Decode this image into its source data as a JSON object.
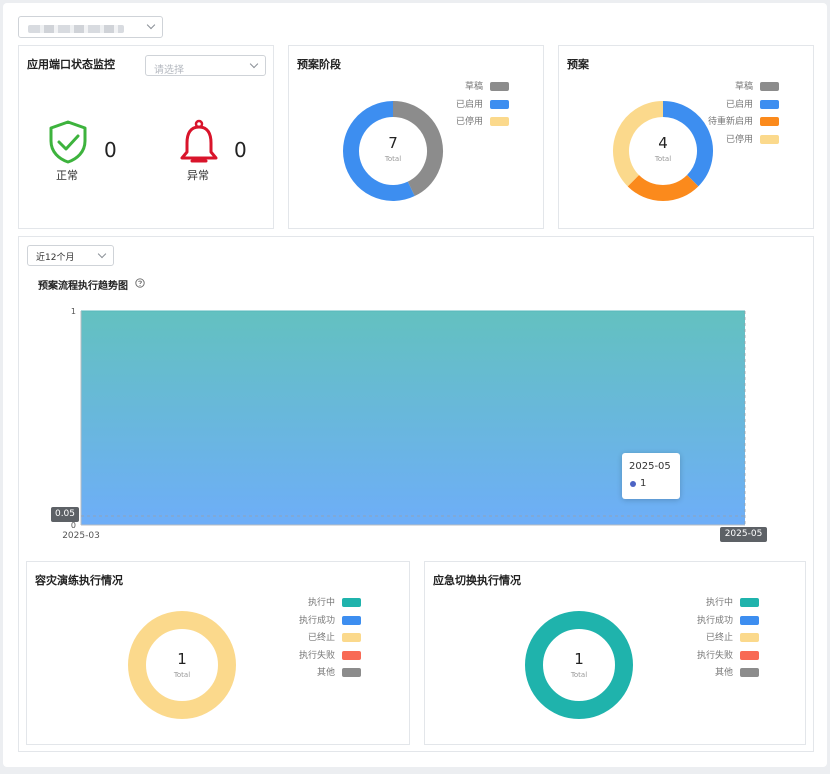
{
  "top_select": {
    "value_obscured": true
  },
  "monitor_card": {
    "title": "应用端口状态监控",
    "select_placeholder": "请选择",
    "normal": {
      "value": "0",
      "label": "正常",
      "icon": "shield-check-icon",
      "color": "#3db33d"
    },
    "abnormal": {
      "value": "0",
      "label": "异常",
      "icon": "bell-icon",
      "color": "#d9142b"
    }
  },
  "stage_card": {
    "title": "预案阶段",
    "total": "7",
    "total_label": "Total",
    "legend": [
      {
        "label": "草稿",
        "color": "#8c8c8c"
      },
      {
        "label": "已启用",
        "color": "#3d8ef0"
      },
      {
        "label": "已停用",
        "color": "#fbd98c"
      }
    ],
    "donut": {
      "values": [
        3,
        4,
        0
      ],
      "colors": [
        "#8c8c8c",
        "#3d8ef0",
        "#fbd98c"
      ]
    }
  },
  "plan_card": {
    "title": "预案",
    "total": "4",
    "total_label": "Total",
    "legend": [
      {
        "label": "草稿",
        "color": "#8c8c8c"
      },
      {
        "label": "已启用",
        "color": "#3d8ef0"
      },
      {
        "label": "待重新启用",
        "color": "#fb8a1c"
      },
      {
        "label": "已停用",
        "color": "#fbd98c"
      }
    ],
    "donut": {
      "values": [
        0,
        1.5,
        1,
        1.5
      ],
      "colors": [
        "#8c8c8c",
        "#3d8ef0",
        "#fb8a1c",
        "#fbd98c"
      ]
    }
  },
  "trend": {
    "range_select": "近12个月",
    "title": "预案流程执行趋势图",
    "help_icon": "question-circle-icon",
    "chart_data": {
      "type": "area",
      "x": [
        "2025-03",
        "2025-05"
      ],
      "series": [
        {
          "values": [
            1,
            1
          ]
        }
      ],
      "y_ticks": [
        "1",
        "0"
      ],
      "ylim": [
        0,
        1
      ],
      "grid": false,
      "gradient": [
        "#63c1c0",
        "#6eaef8"
      ]
    },
    "crosshair_y_label": "0.05",
    "crosshair_x_label": "2025-05",
    "tooltip": {
      "title": "2025-05",
      "value": "1",
      "dot_color": "#4d64c4"
    }
  },
  "drill_card": {
    "title": "容灾演练执行情况",
    "total": "1",
    "total_label": "Total",
    "legend": [
      {
        "label": "执行中",
        "color": "#1fb3ac"
      },
      {
        "label": "执行成功",
        "color": "#3d8ef0"
      },
      {
        "label": "已终止",
        "color": "#fbd98c"
      },
      {
        "label": "执行失败",
        "color": "#f86a55"
      },
      {
        "label": "其他",
        "color": "#8c8c8c"
      }
    ],
    "donut": {
      "values": [
        0,
        0,
        1,
        0,
        0
      ],
      "colors": [
        "#1fb3ac",
        "#3d8ef0",
        "#fbd98c",
        "#f86a55",
        "#8c8c8c"
      ]
    }
  },
  "switch_card": {
    "title": "应急切换执行情况",
    "total": "1",
    "total_label": "Total",
    "legend": [
      {
        "label": "执行中",
        "color": "#1fb3ac"
      },
      {
        "label": "执行成功",
        "color": "#3d8ef0"
      },
      {
        "label": "已终止",
        "color": "#fbd98c"
      },
      {
        "label": "执行失败",
        "color": "#f86a55"
      },
      {
        "label": "其他",
        "color": "#8c8c8c"
      }
    ],
    "donut": {
      "values": [
        1,
        0,
        0,
        0,
        0
      ],
      "colors": [
        "#1fb3ac",
        "#3d8ef0",
        "#fbd98c",
        "#f86a55",
        "#8c8c8c"
      ]
    }
  }
}
